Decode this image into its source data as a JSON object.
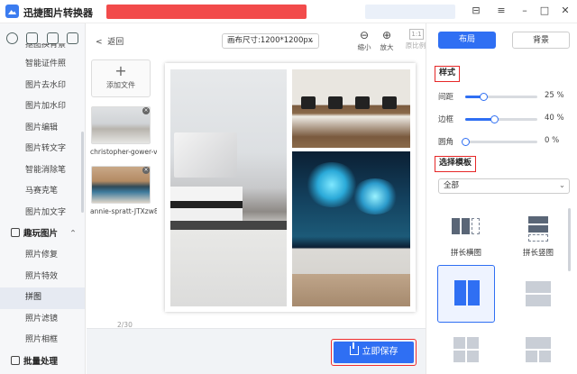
{
  "app": {
    "title": "迅捷图片转换器"
  },
  "window_controls": {
    "skin": "⊟",
    "menu": "≡",
    "minimize": "–",
    "maximize": "□",
    "close": "✕"
  },
  "sidebar": {
    "tab_icons": [
      "scan-icon",
      "convert-icon",
      "image-icon",
      "compress-icon"
    ],
    "items_top": [
      {
        "label": "抠图换背景"
      },
      {
        "label": "智能证件照"
      },
      {
        "label": "图片去水印"
      },
      {
        "label": "图片加水印"
      },
      {
        "label": "图片编辑"
      },
      {
        "label": "图片转文字"
      },
      {
        "label": "智能消除笔"
      },
      {
        "label": "马赛克笔"
      },
      {
        "label": "图片加文字"
      }
    ],
    "group": {
      "label": "趣玩图片",
      "chevron": "⌃"
    },
    "items_group": [
      {
        "label": "照片修复"
      },
      {
        "label": "照片特效"
      },
      {
        "label": "拼图",
        "active": true
      },
      {
        "label": "照片滤镜"
      },
      {
        "label": "照片相框"
      }
    ],
    "bottom_group": {
      "label": "批量处理"
    }
  },
  "toolbar": {
    "back_label": "返回",
    "canvas_size": "画布尺寸:1200*1200px",
    "zoom_out": "缩小",
    "zoom_in": "放大",
    "ratio_box": "1:1",
    "original_ratio": "原比例"
  },
  "files": {
    "add_label": "添加文件",
    "items": [
      {
        "name": "christopher-gower-v4..."
      },
      {
        "name": "annie-spratt-JTXzw8-..."
      }
    ],
    "page_count": "2/30"
  },
  "footer": {
    "save_label": "立即保存"
  },
  "right_panel": {
    "tabs": [
      {
        "label": "布局",
        "active": true
      },
      {
        "label": "背景",
        "active": false
      }
    ],
    "style_title": "样式",
    "sliders": [
      {
        "label": "间距",
        "value": 25,
        "display": "25 %"
      },
      {
        "label": "边框",
        "value": 40,
        "display": "40 %"
      },
      {
        "label": "圆角",
        "value": 0,
        "display": "0 %"
      }
    ],
    "template_title": "选择模板",
    "template_filter": "全部",
    "templates": [
      {
        "label": "拼长横图"
      },
      {
        "label": "拼长竖图"
      },
      {
        "label": "",
        "selected": true
      },
      {
        "label": ""
      },
      {
        "label": ""
      },
      {
        "label": ""
      }
    ]
  }
}
